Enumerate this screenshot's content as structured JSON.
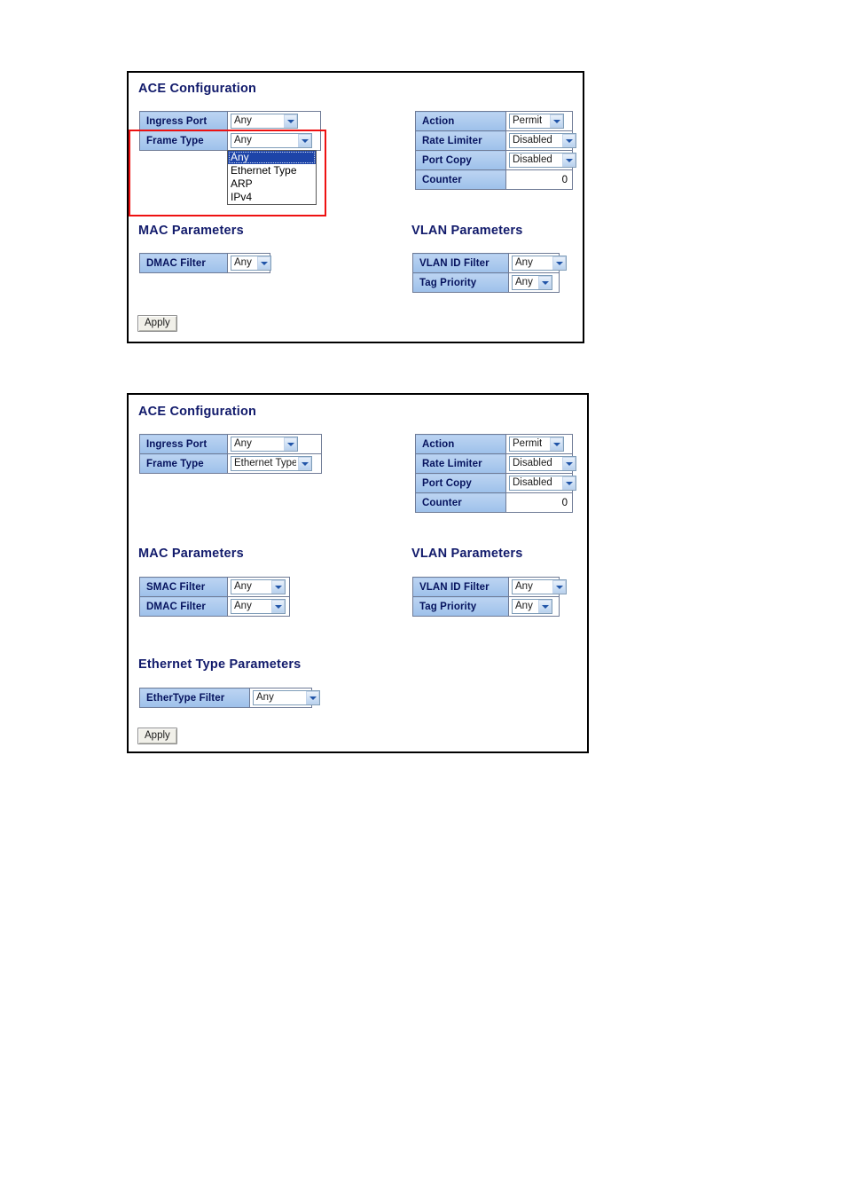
{
  "panels": [
    {
      "title": "ACE Configuration",
      "sections": {
        "mac_heading": "MAC Parameters",
        "vlan_heading": "VLAN Parameters"
      },
      "ace_table": {
        "rows": [
          {
            "label": "Ingress Port",
            "value": "Any"
          },
          {
            "label": "Frame Type",
            "value": "Any"
          }
        ]
      },
      "action_table": {
        "rows": [
          {
            "label": "Action",
            "value": "Permit"
          },
          {
            "label": "Rate Limiter",
            "value": "Disabled"
          },
          {
            "label": "Port Copy",
            "value": "Disabled"
          },
          {
            "label": "Counter",
            "value": "0"
          }
        ]
      },
      "mac_table": {
        "rows": [
          {
            "label": "DMAC Filter",
            "value": "Any"
          }
        ]
      },
      "vlan_table": {
        "rows": [
          {
            "label": "VLAN ID Filter",
            "value": "Any"
          },
          {
            "label": "Tag Priority",
            "value": "Any"
          }
        ]
      },
      "frame_type_dropdown": {
        "open": true,
        "options": [
          "Any",
          "Ethernet Type",
          "ARP",
          "IPv4"
        ],
        "selected": "Any"
      },
      "apply_label": "Apply",
      "annotation_color": "#ee1111"
    },
    {
      "title": "ACE Configuration",
      "sections": {
        "mac_heading": "MAC Parameters",
        "vlan_heading": "VLAN Parameters",
        "ethertype_heading": "Ethernet Type Parameters"
      },
      "ace_table": {
        "rows": [
          {
            "label": "Ingress Port",
            "value": "Any"
          },
          {
            "label": "Frame Type",
            "value": "Ethernet Type"
          }
        ]
      },
      "action_table": {
        "rows": [
          {
            "label": "Action",
            "value": "Permit"
          },
          {
            "label": "Rate Limiter",
            "value": "Disabled"
          },
          {
            "label": "Port Copy",
            "value": "Disabled"
          },
          {
            "label": "Counter",
            "value": "0"
          }
        ]
      },
      "mac_table": {
        "rows": [
          {
            "label": "SMAC Filter",
            "value": "Any"
          },
          {
            "label": "DMAC Filter",
            "value": "Any"
          }
        ]
      },
      "vlan_table": {
        "rows": [
          {
            "label": "VLAN ID Filter",
            "value": "Any"
          },
          {
            "label": "Tag Priority",
            "value": "Any"
          }
        ]
      },
      "ethertype_table": {
        "rows": [
          {
            "label": "EtherType Filter",
            "value": "Any"
          }
        ]
      },
      "apply_label": "Apply"
    }
  ],
  "colors": {
    "heading_text": "#111a6b",
    "label_cell_bg": "#a8c6ee",
    "label_cell_text": "#06135e",
    "annotation": "#ee1111",
    "dropdown_selected_bg": "#1d44a8",
    "panel_border": "#000000"
  }
}
